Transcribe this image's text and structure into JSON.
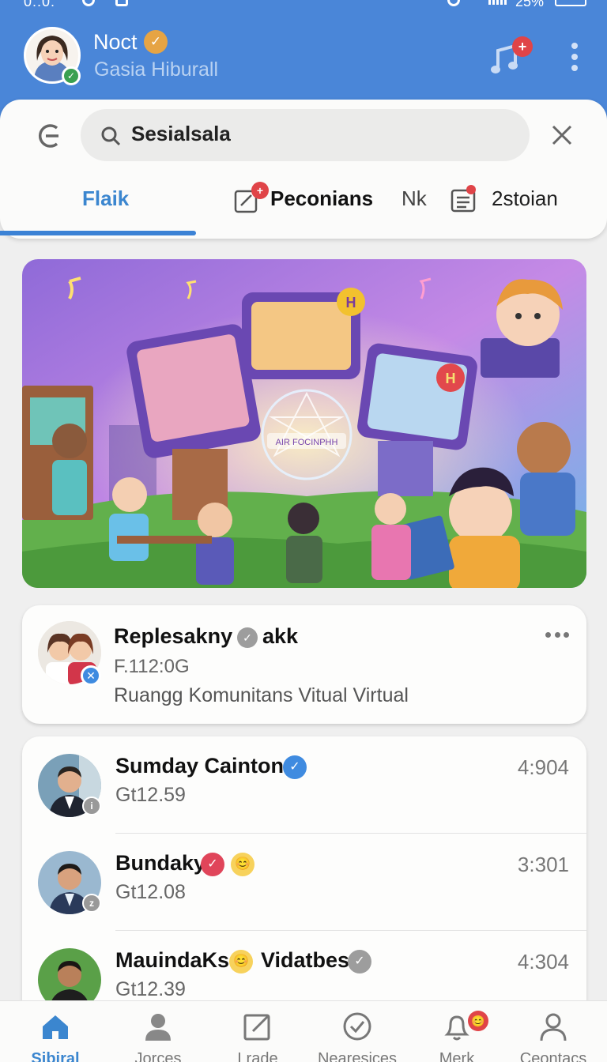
{
  "status": {
    "time": "0:.0:",
    "battery": "25%"
  },
  "profile": {
    "name": "Noct",
    "subtitle": "Gasia Hiburall",
    "badge": "✓",
    "online_mark": "✓"
  },
  "header_icons": {
    "music": "music-note-icon",
    "notif_plus": "+",
    "more": "more-vert-icon"
  },
  "search": {
    "value": "Sesialsala",
    "back_icon": "back-icon",
    "search_icon": "search-icon",
    "clear_icon": "close-icon"
  },
  "tabs": [
    {
      "label": "Flaik",
      "active": true
    },
    {
      "label": "Peconians",
      "icon": "edit-icon",
      "badge": "+"
    },
    {
      "label": "Nk"
    },
    {
      "label": "2stoian",
      "icon": "list-icon",
      "badge": ""
    }
  ],
  "hero": {
    "sign_text": "AIR FOCINPHH",
    "card_letters": "H",
    "image": "virtual-community-illustration"
  },
  "post": {
    "title": "Replesakny",
    "title_after": "akk",
    "time": "F.112:0G",
    "description": "Ruangg Komunitans Vitual Virtual",
    "verify": "✕",
    "badge": "✓"
  },
  "contacts": [
    {
      "name": "Sumday Cainton",
      "badge": "✓",
      "badge_color": "#3f8be0",
      "sub": "Gt12.59",
      "time": "4:904",
      "status": "i"
    },
    {
      "name": "Bundaky",
      "badge": "✓",
      "badge_color": "#e0455a",
      "emoji": "😊",
      "sub": "Gt12.08",
      "time": "3:301",
      "status": "z"
    },
    {
      "name": "MauindaKs",
      "emoji": "😊",
      "name_after": "Vidatbes",
      "badge": "✓",
      "badge_color": "#9d9d9d",
      "sub": "Gt12.39",
      "time": "4:304",
      "status": ""
    }
  ],
  "nav": [
    {
      "label": "Sibiral",
      "icon": "home-icon",
      "active": true
    },
    {
      "label": "Jorces",
      "icon": "person-icon"
    },
    {
      "label": "Lrade",
      "icon": "edit-icon"
    },
    {
      "label": "Nearesices",
      "icon": "check-circle-icon"
    },
    {
      "label": "Merk",
      "icon": "bell-icon",
      "badge": "😊"
    },
    {
      "label": "Ceontacs",
      "icon": "profile-icon"
    }
  ],
  "colors": {
    "primary": "#4a86d8",
    "accent": "#3b86cf",
    "alert": "#e04448"
  }
}
